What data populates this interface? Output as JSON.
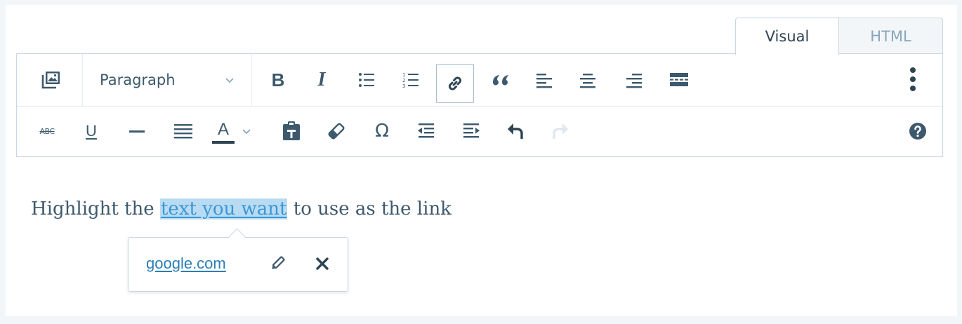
{
  "tabs": [
    {
      "label": "Visual",
      "active": true
    },
    {
      "label": "HTML",
      "active": false
    }
  ],
  "toolbar": {
    "format_select": {
      "value": "Paragraph"
    },
    "row1_icons": [
      "add-media-icon",
      "bold-icon",
      "italic-icon",
      "bulleted-list-icon",
      "numbered-list-icon",
      "link-icon",
      "blockquote-icon",
      "align-left-icon",
      "align-center-icon",
      "align-right-icon",
      "read-more-icon",
      "more-options-icon"
    ],
    "row2_icons": [
      "strikethrough-icon",
      "underline-icon",
      "horizontal-rule-icon",
      "justify-icon",
      "text-color-icon",
      "paste-as-text-icon",
      "clear-formatting-icon",
      "special-character-icon",
      "outdent-icon",
      "indent-icon",
      "undo-icon",
      "redo-icon",
      "help-icon"
    ],
    "glyphs": {
      "bold": "B",
      "italic": "I",
      "underline": "U",
      "text_color": "A",
      "omega": "Ω",
      "strikethrough": "ABC"
    },
    "active_button": "link-icon",
    "redo_enabled": false
  },
  "content": {
    "before": "Highlight the ",
    "link_text": "text you want",
    "after": " to use as the link"
  },
  "link_popover": {
    "url": "google.com"
  },
  "colors": {
    "link": "#3a97d8",
    "selection": "#b9dbf2",
    "border": "#c8d7e1",
    "icon": "#3d596d",
    "muted": "#87a6bc"
  }
}
